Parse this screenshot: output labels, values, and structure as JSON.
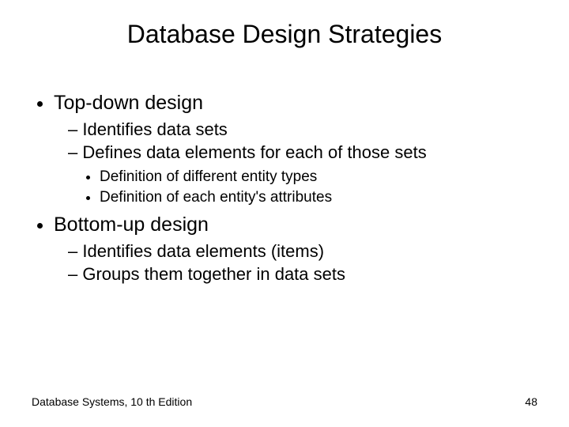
{
  "title": "Database Design Strategies",
  "bullets": {
    "b1": "Top-down design",
    "b1_1": "Identifies data sets",
    "b1_2": "Defines data elements for each of those sets",
    "b1_2_1": "Definition of different entity types",
    "b1_2_2": "Definition of each entity's attributes",
    "b2": "Bottom-up design",
    "b2_1": "Identifies data elements (items)",
    "b2_2": "Groups them together in data sets"
  },
  "footer": {
    "left": "Database Systems, 10 th Edition",
    "right": "48"
  }
}
